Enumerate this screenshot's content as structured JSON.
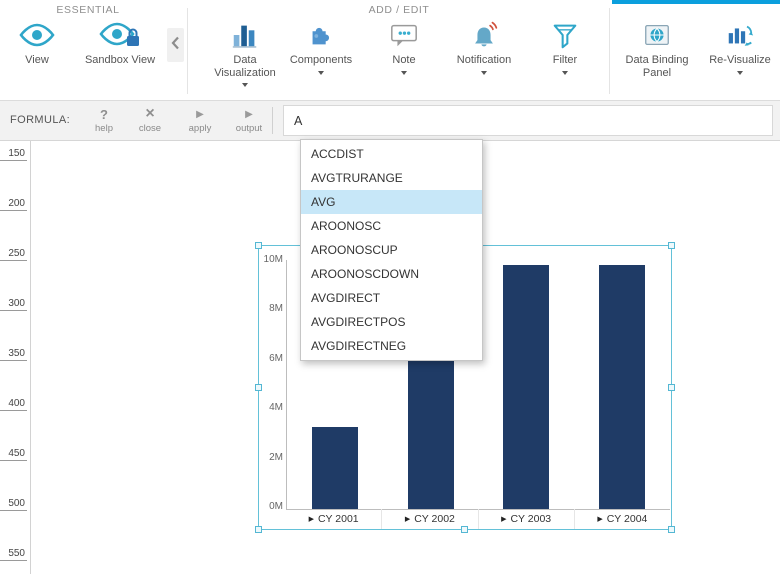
{
  "ribbon": {
    "groups": [
      {
        "label": "ESSENTIAL",
        "active": false,
        "items": [
          {
            "label": "View",
            "icon": "eye-icon",
            "has_dropdown": false
          },
          {
            "label": "Sandbox View",
            "icon": "eye-lock-icon",
            "has_dropdown": false
          }
        ]
      },
      {
        "label": "ADD / EDIT",
        "active": false,
        "items": [
          {
            "label": "Data Visualization",
            "icon": "bar-chart-icon",
            "has_dropdown": true
          },
          {
            "label": "Components",
            "icon": "puzzle-icon",
            "has_dropdown": true
          },
          {
            "label": "Note",
            "icon": "note-icon",
            "has_dropdown": true
          },
          {
            "label": "Notification",
            "icon": "bell-icon",
            "has_dropdown": true
          },
          {
            "label": "Filter",
            "icon": "filter-icon",
            "has_dropdown": true
          }
        ]
      },
      {
        "label": "",
        "active": true,
        "items": [
          {
            "label": "Data Binding Panel",
            "icon": "data-binding-icon",
            "has_dropdown": false
          },
          {
            "label": "Re-Visualize",
            "icon": "revisualize-icon",
            "has_dropdown": true
          }
        ]
      }
    ]
  },
  "formula_bar": {
    "label": "FORMULA:",
    "buttons": [
      {
        "label": "help",
        "icon": "?"
      },
      {
        "label": "close",
        "icon": "×"
      },
      {
        "label": "apply",
        "icon": "▶"
      },
      {
        "label": "output",
        "icon": "▶"
      }
    ],
    "input_value": "A"
  },
  "autocomplete": {
    "items": [
      "ACCDIST",
      "AVGTRURANGE",
      "AVG",
      "AROONOSC",
      "AROONOSCUP",
      "AROONOSCDOWN",
      "AVGDIRECT",
      "AVGDIRECTPOS",
      "AVGDIRECTNEG"
    ],
    "selected_index": 2,
    "selected_item": "AVG"
  },
  "ruler": {
    "marks": [
      "150",
      "200",
      "250",
      "300",
      "350",
      "400",
      "450",
      "500",
      "550"
    ]
  },
  "icons": {
    "drill": "▶"
  },
  "chart_data": {
    "type": "bar",
    "title": "",
    "categories": [
      "CY 2001",
      "CY 2002",
      "CY 2003",
      "CY 2004"
    ],
    "values": [
      3.3,
      6.0,
      9.8,
      9.8
    ],
    "value_unit": "M",
    "y_ticks": [
      "10M",
      "8M",
      "6M",
      "4M",
      "2M",
      "0M"
    ],
    "ylim": [
      0,
      10
    ],
    "grid": false,
    "legend": false,
    "bar_color": "#1f3b66",
    "selected": true
  },
  "colors": {
    "accent_blue": "#0b9fdd",
    "icon_teal": "#2fa6c9",
    "icon_blue": "#2e75b6",
    "bar_navy": "#1f3b66",
    "selection_teal": "#63c1d8",
    "dropdown_highlight": "#c7e7f8",
    "formula_bar_bg": "#f2f2f2"
  }
}
